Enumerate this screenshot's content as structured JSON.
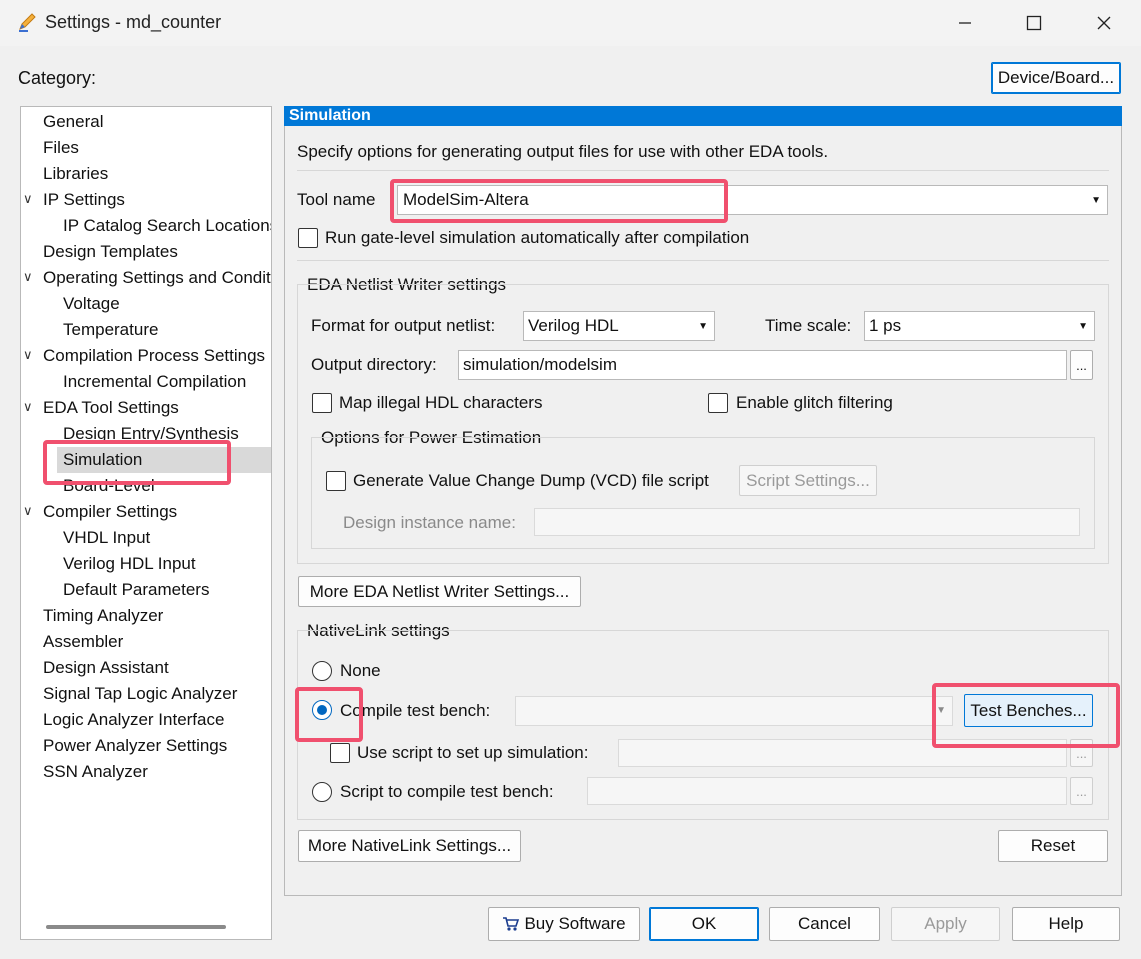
{
  "window": {
    "title": "Settings - md_counter",
    "minimize": "—",
    "maximize": "☐",
    "close": "✕"
  },
  "category_label": "Category:",
  "device_board_button": "Device/Board...",
  "tree": [
    {
      "label": "General",
      "indent": 0,
      "chevron": ""
    },
    {
      "label": "Files",
      "indent": 0,
      "chevron": ""
    },
    {
      "label": "Libraries",
      "indent": 0,
      "chevron": ""
    },
    {
      "label": "IP Settings",
      "indent": 0,
      "chevron": "∨"
    },
    {
      "label": "IP Catalog Search Locations",
      "indent": 1,
      "chevron": ""
    },
    {
      "label": "Design Templates",
      "indent": 0,
      "chevron": ""
    },
    {
      "label": "Operating Settings and Conditions",
      "indent": 0,
      "chevron": "∨"
    },
    {
      "label": "Voltage",
      "indent": 1,
      "chevron": ""
    },
    {
      "label": "Temperature",
      "indent": 1,
      "chevron": ""
    },
    {
      "label": "Compilation Process Settings",
      "indent": 0,
      "chevron": "∨"
    },
    {
      "label": "Incremental Compilation",
      "indent": 1,
      "chevron": ""
    },
    {
      "label": "EDA Tool Settings",
      "indent": 0,
      "chevron": "∨"
    },
    {
      "label": "Design Entry/Synthesis",
      "indent": 1,
      "chevron": ""
    },
    {
      "label": "Simulation",
      "indent": 1,
      "chevron": "",
      "selected": true
    },
    {
      "label": "Board-Level",
      "indent": 1,
      "chevron": ""
    },
    {
      "label": "Compiler Settings",
      "indent": 0,
      "chevron": "∨"
    },
    {
      "label": "VHDL Input",
      "indent": 1,
      "chevron": ""
    },
    {
      "label": "Verilog HDL Input",
      "indent": 1,
      "chevron": ""
    },
    {
      "label": "Default Parameters",
      "indent": 1,
      "chevron": ""
    },
    {
      "label": "Timing Analyzer",
      "indent": 0,
      "chevron": ""
    },
    {
      "label": "Assembler",
      "indent": 0,
      "chevron": ""
    },
    {
      "label": "Design Assistant",
      "indent": 0,
      "chevron": ""
    },
    {
      "label": "Signal Tap Logic Analyzer",
      "indent": 0,
      "chevron": ""
    },
    {
      "label": "Logic Analyzer Interface",
      "indent": 0,
      "chevron": ""
    },
    {
      "label": "Power Analyzer Settings",
      "indent": 0,
      "chevron": ""
    },
    {
      "label": "SSN Analyzer",
      "indent": 0,
      "chevron": ""
    }
  ],
  "panel": {
    "header": "Simulation",
    "description": "Specify options for generating output files for use with other EDA tools.",
    "tool_name_label": "Tool name",
    "tool_name_value": "ModelSim-Altera",
    "run_gate_level_label": "Run gate-level simulation automatically after compilation",
    "eda_group_title": "EDA Netlist Writer settings",
    "format_label": "Format for output netlist:",
    "format_value": "Verilog HDL",
    "time_scale_label": "Time scale:",
    "time_scale_value": "1 ps",
    "output_dir_label": "Output directory:",
    "output_dir_value": "simulation/modelsim",
    "browse": "...",
    "map_illegal_label": "Map illegal HDL characters",
    "glitch_label": "Enable glitch filtering",
    "power_group_title": "Options for Power Estimation",
    "vcd_label": "Generate Value Change Dump (VCD) file script",
    "script_settings_button": "Script Settings...",
    "design_instance_label": "Design instance name:",
    "more_eda_button": "More EDA Netlist Writer Settings...",
    "nativelink_title": "NativeLink settings",
    "none_label": "None",
    "compile_tb_label": "Compile test bench:",
    "test_benches_button": "Test Benches...",
    "use_script_label": "Use script to set up simulation:",
    "script_compile_label": "Script to compile test bench:",
    "more_nativelink_button": "More NativeLink Settings...",
    "reset_button": "Reset"
  },
  "footer": {
    "buy_software": "Buy Software",
    "ok": "OK",
    "cancel": "Cancel",
    "apply": "Apply",
    "help": "Help"
  },
  "colors": {
    "accent": "#0078d7",
    "annotation": "#f0506e"
  }
}
